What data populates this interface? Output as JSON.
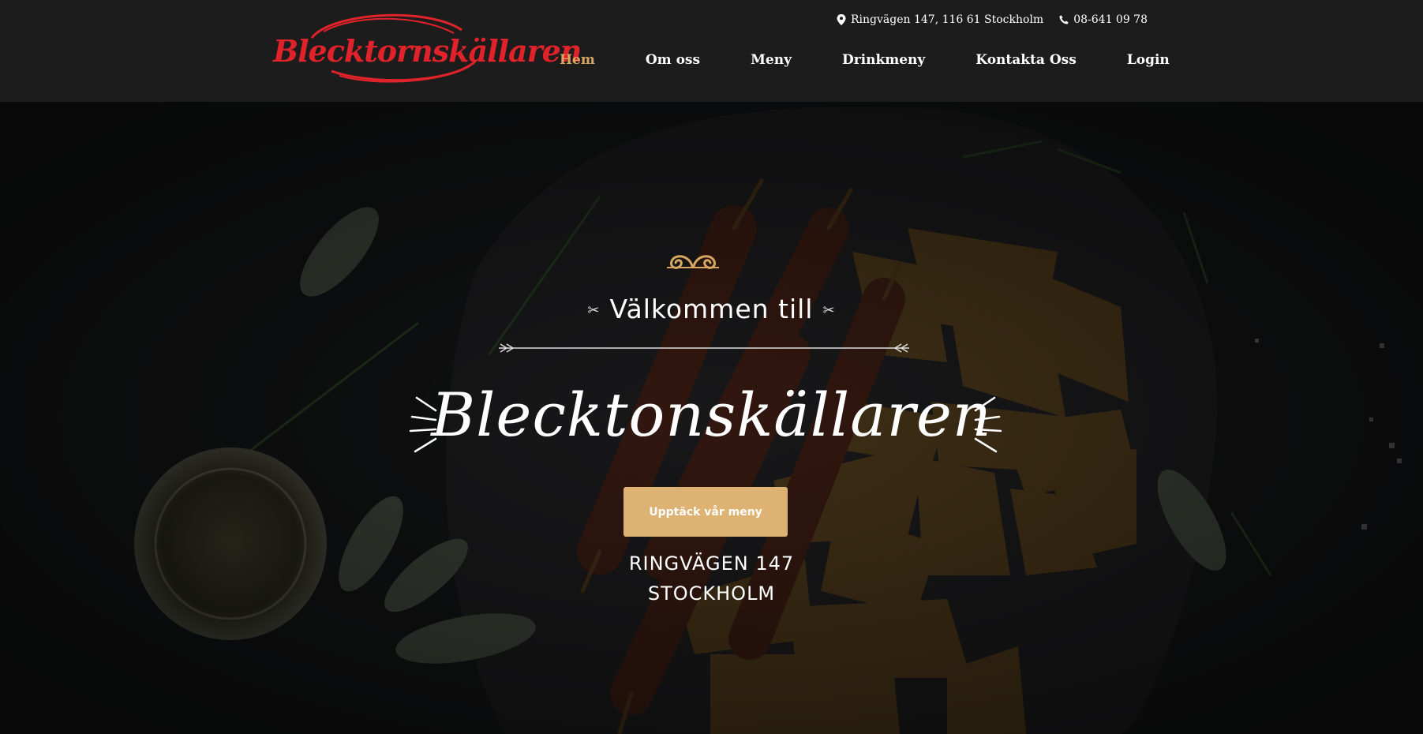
{
  "brand": {
    "logo_text": "Blecktornskällaren",
    "logo_color": "#e0232a"
  },
  "topbar": {
    "address": "Ringvägen 147, 116 61 Stockholm",
    "address_icon": "map-pin-icon",
    "phone": "08-641 09 78",
    "phone_icon": "phone-icon"
  },
  "nav": {
    "items": [
      {
        "label": "Hem",
        "active": true
      },
      {
        "label": "Om oss"
      },
      {
        "label": "Meny"
      },
      {
        "label": "Drinkmeny"
      },
      {
        "label": "Kontakta Oss"
      },
      {
        "label": "Login"
      }
    ],
    "active_color": "#d8a863"
  },
  "hero": {
    "welcome": "Välkommen till",
    "title": "Blecktonskällaren",
    "cta_label": "Upptäck vår meny",
    "cta_color": "#ddb272",
    "address_line1": "RINGVÄGEN 147",
    "address_line2": "STOCKHOLM"
  }
}
